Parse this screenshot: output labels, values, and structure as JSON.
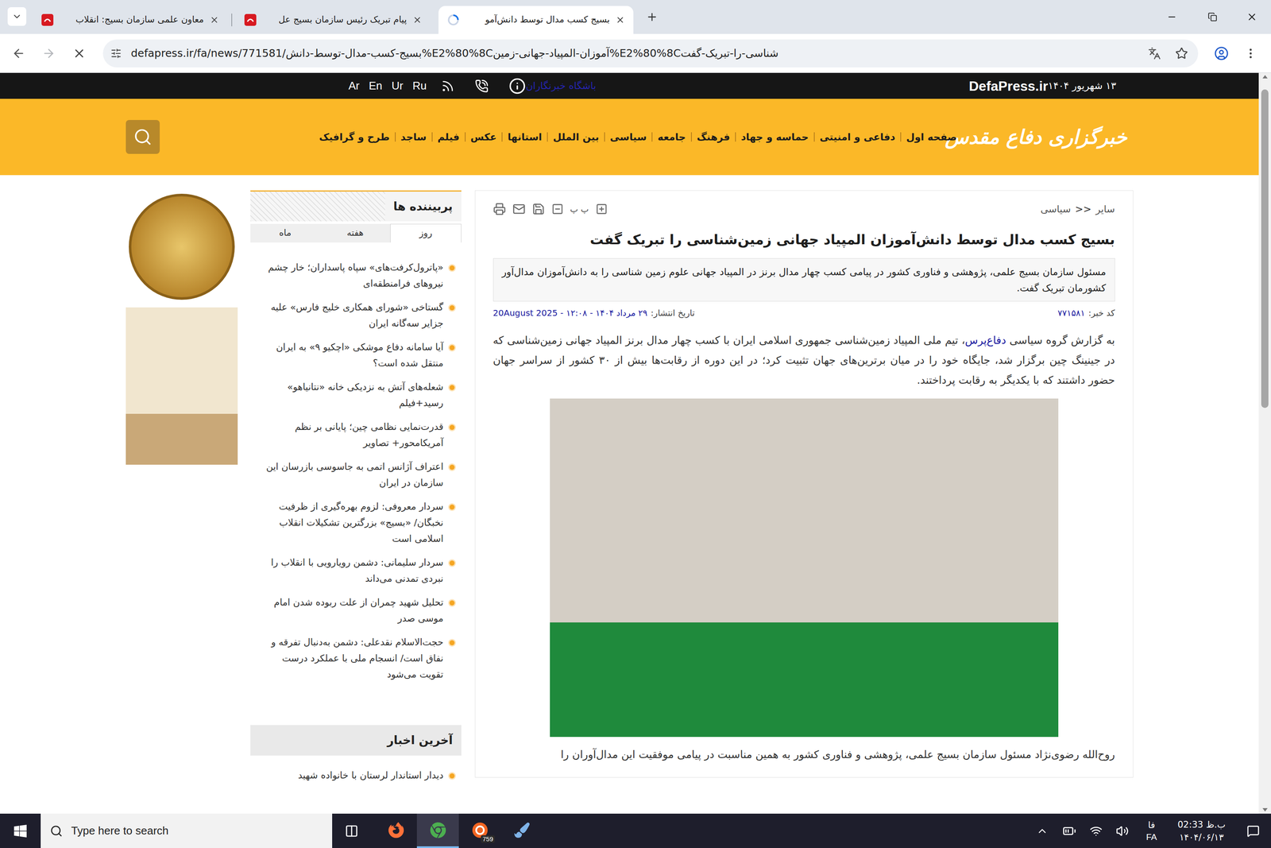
{
  "browser": {
    "tabs": [
      {
        "title": "معاون علمی سازمان بسیج: انقلاب",
        "selected": false,
        "kind": "site"
      },
      {
        "title": "پیام تبریک رئیس سازمان بسیج عل",
        "selected": false,
        "kind": "site"
      },
      {
        "title": "بسیج کسب مدال توسط دانش‌آمو",
        "selected": true,
        "kind": "loading"
      }
    ],
    "nav": {
      "back_enabled": true,
      "forward_enabled": false,
      "loading": true
    },
    "url": "defapress.ir/fa/news/771581/بسیج-کسب-مدال-توسط-دانش%E2%80%8Cآموزان-المپیاد-جهانی-زمین%E2%80%8Cشناسی-را-تبریک-گفت",
    "scrollbar": {
      "offset": 0.011,
      "size": 0.44
    }
  },
  "site": {
    "topbar": {
      "date": "۱۳ شهریور ۱۴۰۴",
      "brand": "DefaPress.ir",
      "link": "باشگاه خبرنگاران",
      "languages": [
        "Ar",
        "En",
        "Ur",
        "Ru"
      ]
    },
    "header": {
      "logo": "خبرگزاری دفاع مقدس",
      "nav": [
        "صفحه اول",
        "دفاعی و امنیتی",
        "حماسه و جهاد",
        "فرهنگ",
        "جامعه",
        "سیاسی",
        "بین الملل",
        "استانها",
        "عکس",
        "فیلم",
        "ساجد",
        "طرح و گرافیک"
      ]
    },
    "article": {
      "breadcrumb": {
        "items": [
          "سیاسی",
          "سایر"
        ],
        "separator": ">>"
      },
      "font_icon": "پ پ",
      "title": "بسیج کسب مدال توسط دانش‌آموزان المپیاد جهانی زمین‌شناسی را تبریک گفت",
      "lead": "مسئول سازمان بسیج علمی، پژوهشی و فناوری کشور در پیامی کسب چهار مدال برنز در المپیاد جهانی علوم زمین شناسی را به دانش‌آموزان مدال‌آور کشورمان تبریک گفت.",
      "code_label": "کد خبر:",
      "code": "۷۷۱۵۸۱",
      "date_label": "تاریخ انتشار:",
      "date": "۲۹ مرداد ۱۴۰۴ - ۱۲:۰۸ - 20August 2025",
      "body_prefix": "به گزارش گروه سیاسی ",
      "body_link": "دفاع‌پرس",
      "body_suffix": "، تیم ملی المپیاد زمین‌شناسی جمهوری اسلامی ایران با کسب چهار مدال برنز المپیاد جهانی زمین‌شناسی که در جینینگ چین برگزار شد، جایگاه خود را در میان برترین‌های جهان تثبیت کرد؛ در این دوره از رقابت‌ها بیش از ۳۰ کشور از سراسر جهان حضور داشتند که با یکدیگر به رقابت پرداختند.",
      "body_after": "روح‌الله رضوی‌نژاد مسئول سازمان بسیج علمی، پژوهشی و فناوری کشور به همین مناسبت در پیامی موفقیت این مدال‌آوران را"
    },
    "popular": {
      "title": "پربیننده ها",
      "tabs": [
        {
          "label": "روز",
          "selected": true
        },
        {
          "label": "هفته",
          "selected": false
        },
        {
          "label": "ماه",
          "selected": false
        }
      ],
      "items": [
        "«پاترول‌کرفت‌های» سپاه پاسداران؛ خار چشم نیروهای فرامنطقه‌ای",
        "گستاخی «شورای همکاری خلیج فارس» علیه جزایر سه‌گانه ایران",
        "آیا سامانه دفاع موشکی «اچکیو ۹» به ایران منتقل شده است؟",
        "شعله‌های آتش به نزدیکی خانه «نتانیاهو» رسید+فیلم",
        "قدرت‌نمایی نظامی چین؛ پایانی بر نظم آمریکامحور+ تصاویر",
        "اعتراف آژانس اتمی به جاسوسی بازرسان این سازمان در ایران",
        "سردار معروفی: لزوم بهره‌گیری از ظرفیت نخبگان/ «بسیج» بزرگترین تشکیلات انقلاب اسلامی است",
        "سردار سلیمانی: دشمن رویارویی با انقلاب را نبردی تمدنی می‌داند",
        "تحلیل شهید چمران از علت ربوده شدن امام موسی صدر",
        "حجت‌الاسلام نقدعلی: دشمن به‌دنبال تفرقه و نفاق است/ انسجام ملی با عملکرد درست تقویت می‌شود"
      ]
    },
    "latest": {
      "title": "آخرین اخبار",
      "items": [
        "دیدار استاندار لرستان با خانواده شهید"
      ]
    }
  },
  "taskbar": {
    "search_placeholder": "Type here to search",
    "apps": [
      {
        "kind": "firefox",
        "selected": false
      },
      {
        "kind": "chrome",
        "selected": true
      },
      {
        "kind": "app",
        "selected": false,
        "badge": "759"
      },
      {
        "kind": "paint",
        "selected": false
      }
    ],
    "lang_native": "فا",
    "lang_code": "FA",
    "time": "02:33 ب.ظ",
    "date": "۱۴۰۴/۰۶/۱۳"
  }
}
